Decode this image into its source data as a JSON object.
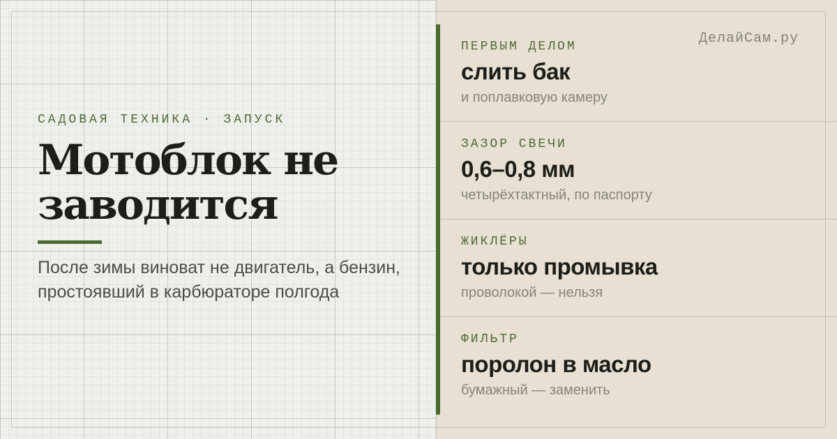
{
  "left": {
    "kicker": "САДОВАЯ ТЕХНИКА · ЗАПУСК",
    "title": "Мотоблок не заводится",
    "lede": "После зимы виноват не двигатель, а бензин, простоявший в карбюраторе полгода"
  },
  "brand": "ДелайСам.ру",
  "tips": [
    {
      "label": "ПЕРВЫМ ДЕЛОМ",
      "value": "слить бак",
      "note": "и поплавковую камеру"
    },
    {
      "label": "ЗАЗОР СВЕЧИ",
      "value": "0,6–0,8 мм",
      "note": "четырёхтактный, по паспорту"
    },
    {
      "label": "ЖИКЛЁРЫ",
      "value": "только промывка",
      "note": "проволокой — нельзя"
    },
    {
      "label": "ФИЛЬТР",
      "value": "поролон в масло",
      "note": "бумажный — заменить"
    }
  ],
  "colors": {
    "accent": "#4a6a2e",
    "left_bg": "#eef0ec",
    "right_bg": "#e7e0d3",
    "text_dark": "#1c1e1a"
  }
}
